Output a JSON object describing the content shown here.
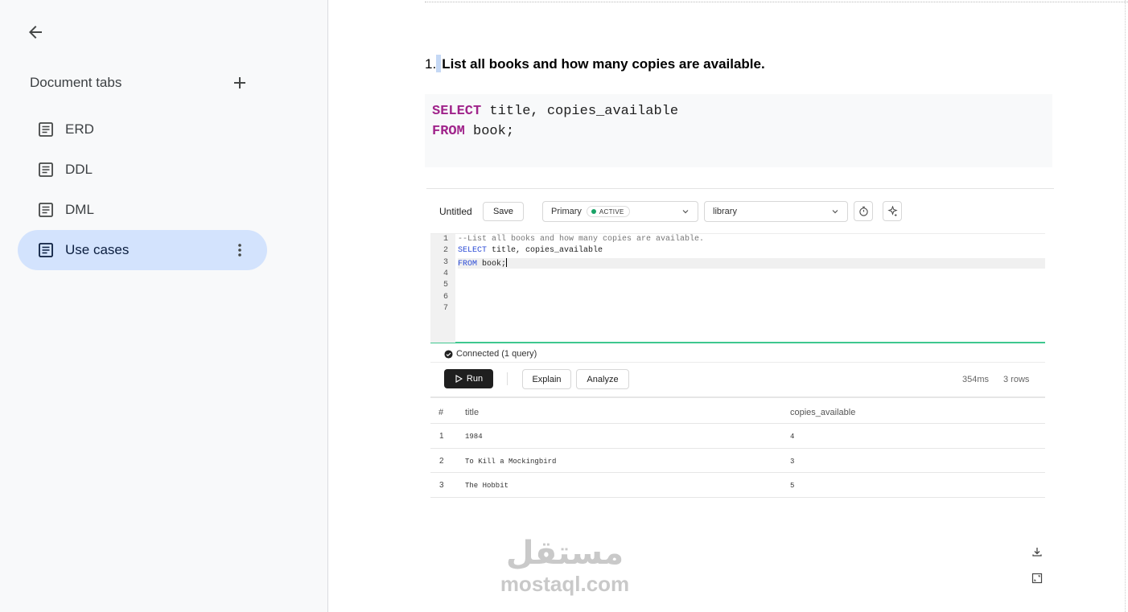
{
  "sidebar": {
    "header": "Document tabs",
    "tabs": [
      {
        "label": "ERD"
      },
      {
        "label": "DDL"
      },
      {
        "label": "DML"
      },
      {
        "label": "Use cases"
      }
    ]
  },
  "document": {
    "heading_number": "1.",
    "heading_text": "List all books and how many copies are available.",
    "code": {
      "line1_kw": "SELECT",
      "line1_rest": " title, copies_available",
      "line2_kw": "FROM",
      "line2_rest": " book;"
    }
  },
  "screenshot": {
    "query_name": "Untitled",
    "save_label": "Save",
    "connection": "Primary",
    "connection_badge": "ACTIVE",
    "database": "library",
    "editor": {
      "line_numbers": [
        "1",
        "2",
        "3",
        "4",
        "5",
        "6",
        "7"
      ],
      "comment": "--List all books and how many copies are available.",
      "kw_select": "SELECT",
      "select_rest": " title, copies_available",
      "kw_from": "FROM",
      "from_rest": " book;"
    },
    "status": "Connected (1 query)",
    "run_label": "Run",
    "explain_label": "Explain",
    "analyze_label": "Analyze",
    "duration": "354ms",
    "row_count": "3 rows",
    "results": {
      "headers": [
        "#",
        "title",
        "copies_available"
      ],
      "rows": [
        [
          "1",
          "1984",
          "4"
        ],
        [
          "2",
          "To Kill a Mockingbird",
          "3"
        ],
        [
          "3",
          "The Hobbit",
          "5"
        ]
      ]
    }
  },
  "watermark": {
    "arabic": "مستقل",
    "latin": "mostaql.com"
  },
  "colors": {
    "active_tab_bg": "#d3e3fd",
    "sql_keyword": "#a0248b",
    "editor_keyword": "#2a4ad6",
    "editor_border": "#3ec78f",
    "active_dot": "#1aa367"
  }
}
